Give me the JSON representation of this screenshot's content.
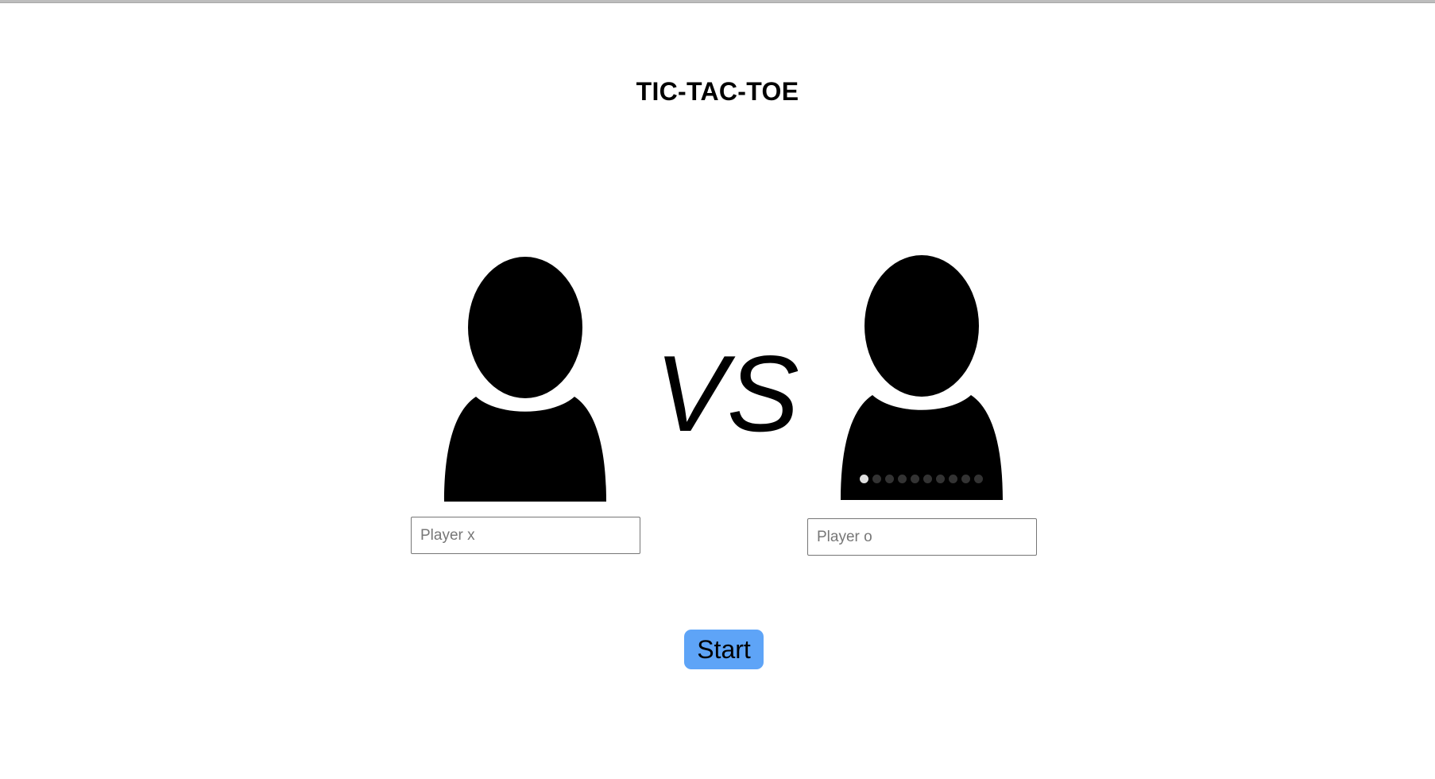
{
  "header": {
    "title": "TIC-TAC-TOE"
  },
  "players": {
    "x": {
      "avatar_icon": "person-silhouette-icon",
      "input_value": "",
      "input_placeholder": "Player x"
    },
    "o": {
      "avatar_icon": "person-silhouette-icon",
      "input_value": "",
      "input_placeholder": "Player o"
    }
  },
  "versus_label": "VS",
  "carousel": {
    "total_dots": 10,
    "active_index": 0
  },
  "start_button": {
    "label": "Start",
    "color": "#5ea4f7"
  }
}
